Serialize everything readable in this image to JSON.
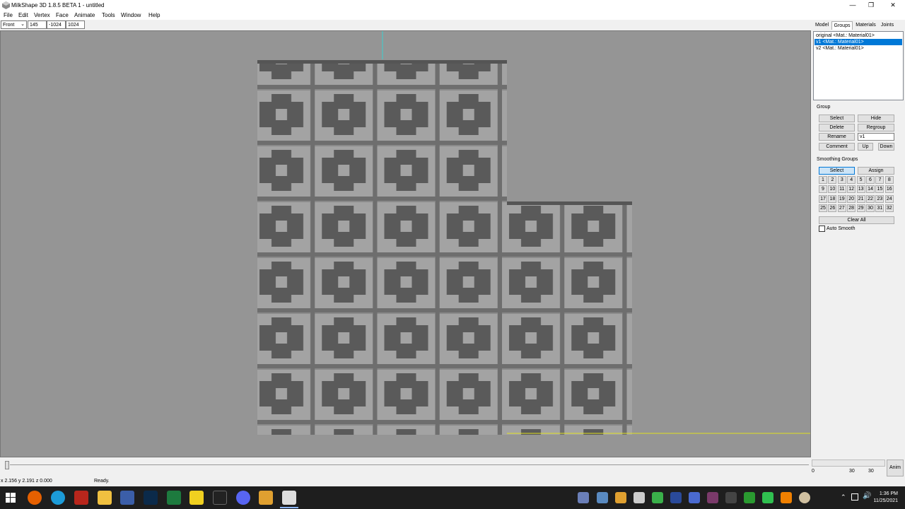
{
  "window": {
    "title": "MilkShape 3D 1.8.5 BETA 1 - untitled"
  },
  "menu": [
    "File",
    "Edit",
    "Vertex",
    "Face",
    "Animate",
    "Tools",
    "Window",
    "Help"
  ],
  "toolbar": {
    "view": "Front",
    "x": "145",
    "y": "-1024",
    "z": "1024"
  },
  "tabs": [
    "Model",
    "Groups",
    "Materials",
    "Joints"
  ],
  "active_tab": "Groups",
  "groups": [
    {
      "label": "original <Mat.: Material01>"
    },
    {
      "label": "v1 <Mat.: Material01>",
      "selected": true
    },
    {
      "label": "v2 <Mat.: Material01>"
    }
  ],
  "group_section": {
    "title": "Group",
    "select": "Select",
    "hide": "Hide",
    "delete": "Delete",
    "regroup": "Regroup",
    "rename": "Rename",
    "rename_value": "v1",
    "comment": "Comment",
    "up": "Up",
    "down": "Down"
  },
  "smoothing": {
    "title": "Smoothing Groups",
    "select": "Select",
    "assign": "Assign",
    "numbers": [
      "1",
      "2",
      "3",
      "4",
      "5",
      "6",
      "7",
      "8",
      "9",
      "10",
      "11",
      "12",
      "13",
      "14",
      "15",
      "16",
      "17",
      "18",
      "19",
      "20",
      "21",
      "22",
      "23",
      "24",
      "25",
      "26",
      "27",
      "28",
      "29",
      "30",
      "31",
      "32"
    ],
    "clear_all": "Clear All",
    "auto_smooth": "Auto Smooth"
  },
  "timeline": {
    "anim": "Anim",
    "frame": "0",
    "end1": "30",
    "end2": "30"
  },
  "status": {
    "coords": "x 2.156 y 2.191 z 0.000",
    "message": "Ready."
  },
  "taskbar": {
    "time": "1:36 PM",
    "date": "11/25/2021"
  },
  "colors": {
    "viewport": "#959595",
    "selection": "#0078d7",
    "taskbar": "#1e1e1e"
  }
}
